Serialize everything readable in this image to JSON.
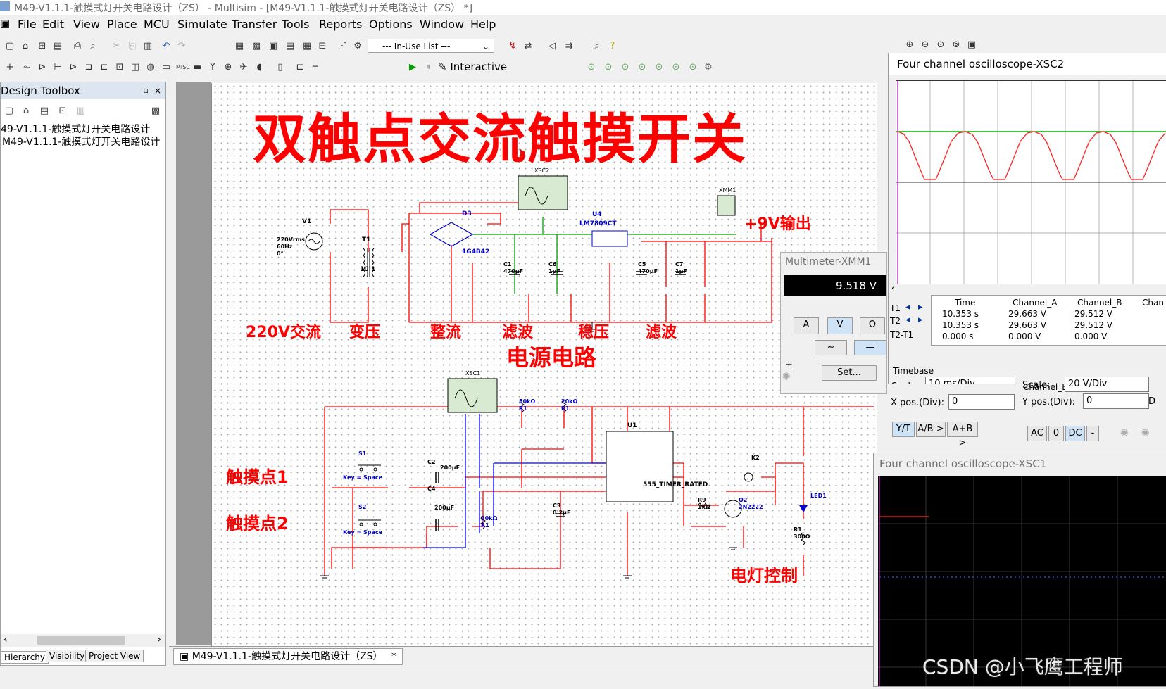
{
  "window": {
    "title": "M49-V1.1.1-触摸式灯开关电路设计（ZS） - Multisim - [M49-V1.1.1-触摸式灯开关电路设计（ZS） *]"
  },
  "menu": [
    "File",
    "Edit",
    "View",
    "Place",
    "MCU",
    "Simulate",
    "Transfer",
    "Tools",
    "Reports",
    "Options",
    "Window",
    "Help"
  ],
  "toolbar": {
    "in_use_list": "--- In-Use List ---",
    "interactive": "Interactive"
  },
  "toolbox": {
    "title": "Design Toolbox",
    "tree": [
      "49-V1.1.1-触摸式灯开关电路设计",
      "M49-V1.1.1-触摸式灯开关电路设计"
    ],
    "tabs": [
      "Hierarchy",
      "Visibility",
      "Project View"
    ]
  },
  "doc_tab": "M49-V1.1.1-触摸式灯开关电路设计（ZS）",
  "doc_tab_close": "*",
  "schematic": {
    "headline": "双触点交流触摸开关",
    "section_labels": [
      "220V交流",
      "变压",
      "整流",
      "滤波",
      "稳压",
      "滤波"
    ],
    "power_circuit": "电源电路",
    "output_label": "+9V输出",
    "touch1": "触摸点1",
    "touch2": "触摸点2",
    "lamp_control": "电灯控制",
    "components": {
      "v1": "V1",
      "v1_spec": [
        "220Vrms",
        "60Hz",
        "0°"
      ],
      "t1": "T1",
      "t1_ratio": "10:1",
      "d3": "D3",
      "d3_model": "1G4B42",
      "u4": "U4",
      "u4_model": "LM7809CT",
      "xsc2": "XSC2",
      "xsc1": "XSC1",
      "xmm1": "XMM1",
      "c1": "C1",
      "c1_val": "470μF",
      "c6": "C6",
      "c6_val": "1μF",
      "c5": "C5",
      "c5_val": "470μF",
      "c7": "C7",
      "c7_val": "1μF",
      "r1a": "50kΩ",
      "r1b": "20kΩ",
      "r1c": "20kΩ",
      "r1_name": "R1",
      "u1": "U1",
      "u1_model": "555_TIMER_RATED",
      "s1": "S1",
      "s2": "S2",
      "key": "Key = Space",
      "c2": "C2",
      "c2_val": "200μF",
      "c4": "C4",
      "c4_val": "200μF",
      "c3": "C3",
      "c3_val": "0.2μF",
      "k2": "K2",
      "r9": "R9",
      "r9_val": "1kΩ",
      "q2": "Q2",
      "q2_model": "2N2222",
      "led1": "LED1",
      "r1_out": "R1",
      "r1_out_val": "300Ω"
    }
  },
  "osc_xsc2": {
    "title": "Four channel oscilloscope-XSC2",
    "headers": [
      "Time",
      "Channel_A",
      "Channel_B",
      "Chan"
    ],
    "t1": [
      "T1",
      "10.353 s",
      "29.663 V",
      "29.512 V"
    ],
    "t2": [
      "T2",
      "10.353 s",
      "29.663 V",
      "29.512 V"
    ],
    "t2t1": [
      "T2-T1",
      "0.000 s",
      "0.000 V",
      "0.000 V"
    ],
    "timebase": "Timebase",
    "scale_label": "Scale:",
    "timebase_scale": "10 ms/Div",
    "xpos_label": "X pos.(Div):",
    "xpos": "0",
    "channel_b": "Channel_B",
    "chb_scale": "20  V/Div",
    "ypos_label": "Y pos.(Div):",
    "ypos": "0",
    "d_label": "D",
    "mode_buttons": [
      "Y/T",
      "A/B >",
      "A+B >"
    ],
    "coupling": [
      "AC",
      "0",
      "DC",
      "-"
    ]
  },
  "multimeter": {
    "title": "Multimeter-XMM1",
    "reading": "9.518 V",
    "modes": [
      "A",
      "V",
      "Ω"
    ],
    "set_button": "Set...",
    "plus": "+"
  },
  "osc_xsc1": {
    "title": "Four channel oscilloscope-XSC1"
  },
  "watermark": "CSDN @小飞鹰工程师",
  "colors": {
    "wire_red": "#ff0000",
    "wire_green": "#00a000",
    "wire_blue": "#0000ff",
    "trace_red": "#ff2020",
    "trace_green": "#00b000"
  }
}
